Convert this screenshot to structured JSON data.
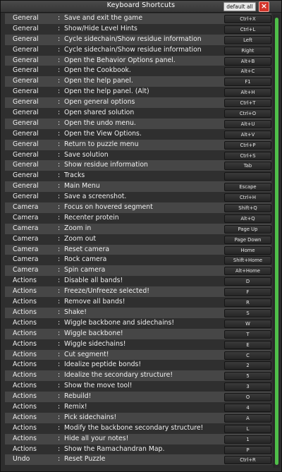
{
  "window": {
    "title": "Keyboard Shortcuts",
    "preset": "default all",
    "close_glyph": "×"
  },
  "separator": ":",
  "shortcuts": [
    {
      "category": "General",
      "action": "Save and exit the game",
      "key": "Ctrl+X"
    },
    {
      "category": "General",
      "action": "Show/Hide Level Hints",
      "key": "Ctrl+L"
    },
    {
      "category": "General",
      "action": "Cycle sidechain/Show residue information",
      "key": "Left"
    },
    {
      "category": "General",
      "action": "Cycle sidechain/Show residue information",
      "key": "Right"
    },
    {
      "category": "General",
      "action": "Open the Behavior Options panel.",
      "key": "Alt+B"
    },
    {
      "category": "General",
      "action": "Open the Cookbook.",
      "key": "Alt+C"
    },
    {
      "category": "General",
      "action": "Open the help panel.",
      "key": "F1"
    },
    {
      "category": "General",
      "action": "Open the help panel. (Alt)",
      "key": "Alt+H"
    },
    {
      "category": "General",
      "action": "Open general options",
      "key": "Ctrl+T"
    },
    {
      "category": "General",
      "action": "Open shared solution",
      "key": "Ctrl+O"
    },
    {
      "category": "General",
      "action": "Open the undo menu.",
      "key": "Alt+U"
    },
    {
      "category": "General",
      "action": "Open the View Options.",
      "key": "Alt+V"
    },
    {
      "category": "General",
      "action": "Return to puzzle menu",
      "key": "Ctrl+P"
    },
    {
      "category": "General",
      "action": "Save solution",
      "key": "Ctrl+S"
    },
    {
      "category": "General",
      "action": "Show residue information",
      "key": "Tab"
    },
    {
      "category": "General",
      "action": "Tracks",
      "key": ""
    },
    {
      "category": "General",
      "action": "Main Menu",
      "key": "Escape"
    },
    {
      "category": "General",
      "action": "Save a screenshot.",
      "key": "Ctrl+H"
    },
    {
      "category": "Camera",
      "action": "Focus on hovered segment",
      "key": "Shift+Q"
    },
    {
      "category": "Camera",
      "action": "Recenter protein",
      "key": "Alt+Q"
    },
    {
      "category": "Camera",
      "action": "Zoom in",
      "key": "Page Up"
    },
    {
      "category": "Camera",
      "action": "Zoom out",
      "key": "Page Down"
    },
    {
      "category": "Camera",
      "action": "Reset camera",
      "key": "Home"
    },
    {
      "category": "Camera",
      "action": "Rock camera",
      "key": "Shift+Home"
    },
    {
      "category": "Camera",
      "action": "Spin camera",
      "key": "Alt+Home"
    },
    {
      "category": "Actions",
      "action": "Disable all bands!",
      "key": "D"
    },
    {
      "category": "Actions",
      "action": "Freeze/Unfreeze selected!",
      "key": "F"
    },
    {
      "category": "Actions",
      "action": "Remove all bands!",
      "key": "R"
    },
    {
      "category": "Actions",
      "action": "Shake!",
      "key": "S"
    },
    {
      "category": "Actions",
      "action": "Wiggle backbone and sidechains!",
      "key": "W"
    },
    {
      "category": "Actions",
      "action": "Wiggle backbone!",
      "key": "T"
    },
    {
      "category": "Actions",
      "action": "Wiggle sidechains!",
      "key": "E"
    },
    {
      "category": "Actions",
      "action": "Cut segment!",
      "key": "C"
    },
    {
      "category": "Actions",
      "action": "Idealize peptide bonds!",
      "key": "2"
    },
    {
      "category": "Actions",
      "action": "Idealize the secondary structure!",
      "key": "5"
    },
    {
      "category": "Actions",
      "action": "Show the move tool!",
      "key": "3"
    },
    {
      "category": "Actions",
      "action": "Rebuild!",
      "key": "O"
    },
    {
      "category": "Actions",
      "action": "Remix!",
      "key": "4"
    },
    {
      "category": "Actions",
      "action": "Pick sidechains!",
      "key": "A"
    },
    {
      "category": "Actions",
      "action": "Modify the backbone secondary structure!",
      "key": "L"
    },
    {
      "category": "Actions",
      "action": "Hide all your notes!",
      "key": "1"
    },
    {
      "category": "Actions",
      "action": "Show the Ramachandran Map.",
      "key": "P"
    },
    {
      "category": "Undo",
      "action": "Reset Puzzle",
      "key": "Ctrl+R"
    }
  ]
}
